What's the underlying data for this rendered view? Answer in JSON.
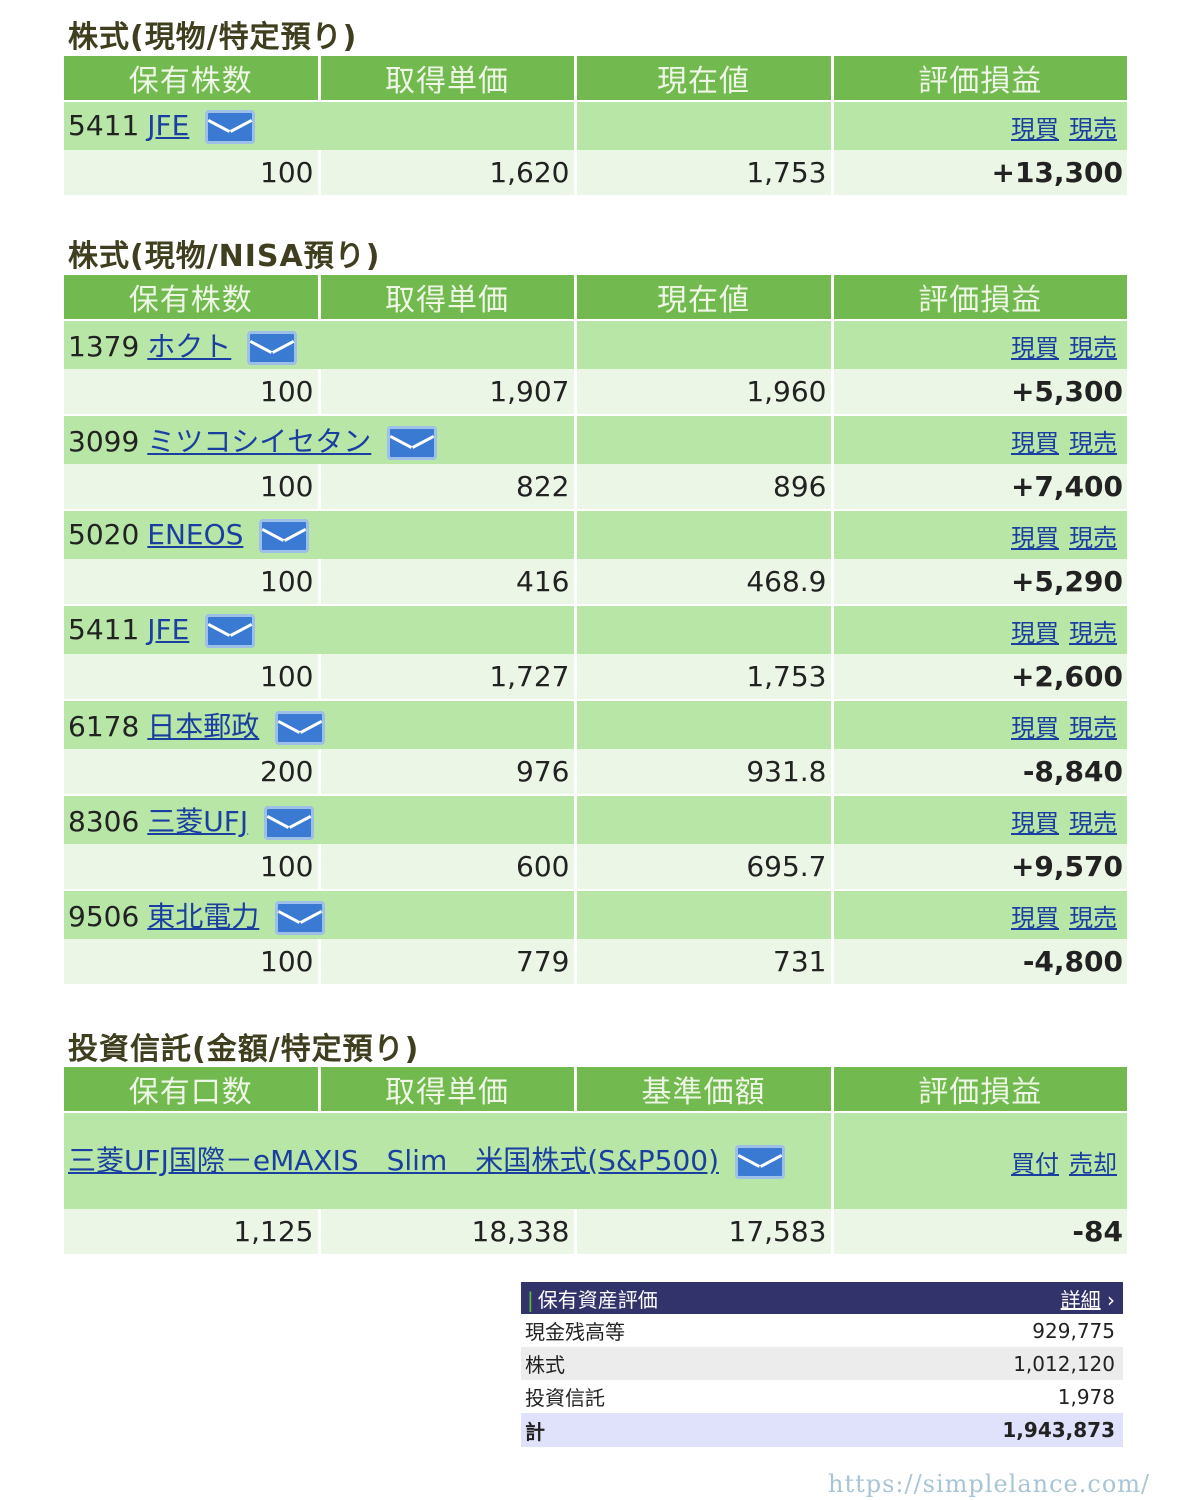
{
  "section1": {
    "title": "株式(現物/特定預り)",
    "headers": [
      "保有株数",
      "取得単価",
      "現在値",
      "評価損益"
    ],
    "stocks": [
      {
        "code": "5411",
        "name": "JFE",
        "buy": "現買",
        "sell": "現売",
        "qty": "100",
        "cost": "1,620",
        "price": "1,753",
        "pl": "+13,300"
      }
    ]
  },
  "section2": {
    "title": "株式(現物/NISA預り)",
    "headers": [
      "保有株数",
      "取得単価",
      "現在値",
      "評価損益"
    ],
    "stocks": [
      {
        "code": "1379",
        "name": "ホクト",
        "buy": "現買",
        "sell": "現売",
        "qty": "100",
        "cost": "1,907",
        "price": "1,960",
        "pl": "+5,300"
      },
      {
        "code": "3099",
        "name": "ミツコシイセタン",
        "buy": "現買",
        "sell": "現売",
        "qty": "100",
        "cost": "822",
        "price": "896",
        "pl": "+7,400"
      },
      {
        "code": "5020",
        "name": "ENEOS",
        "buy": "現買",
        "sell": "現売",
        "qty": "100",
        "cost": "416",
        "price": "468.9",
        "pl": "+5,290"
      },
      {
        "code": "5411",
        "name": "JFE",
        "buy": "現買",
        "sell": "現売",
        "qty": "100",
        "cost": "1,727",
        "price": "1,753",
        "pl": "+2,600"
      },
      {
        "code": "6178",
        "name": "日本郵政",
        "buy": "現買",
        "sell": "現売",
        "qty": "200",
        "cost": "976",
        "price": "931.8",
        "pl": "-8,840"
      },
      {
        "code": "8306",
        "name": "三菱UFJ",
        "buy": "現買",
        "sell": "現売",
        "qty": "100",
        "cost": "600",
        "price": "695.7",
        "pl": "+9,570"
      },
      {
        "code": "9506",
        "name": "東北電力",
        "buy": "現買",
        "sell": "現売",
        "qty": "100",
        "cost": "779",
        "price": "731",
        "pl": "-4,800"
      }
    ]
  },
  "section3": {
    "title": "投資信託(金額/特定預り)",
    "headers": [
      "保有口数",
      "取得単価",
      "基準価額",
      "評価損益"
    ],
    "fund": {
      "name": "三菱UFJ国際－eMAXIS　Slim　米国株式(S&P500)",
      "buy": "買付",
      "sell": "売却",
      "qty": "1,125",
      "cost": "18,338",
      "price": "17,583",
      "pl": "-84"
    }
  },
  "summary": {
    "title": "保有資産評価",
    "detail": "詳細",
    "rows": [
      {
        "label": "現金残高等",
        "value": "929,775"
      },
      {
        "label": "株式",
        "value": "1,012,120"
      },
      {
        "label": "投資信託",
        "value": "1,978"
      }
    ],
    "total": {
      "label": "計",
      "value": "1,943,873"
    }
  },
  "watermark": "https://simplelance.com/",
  "colors": {
    "header_green": "#72b94f",
    "row_green": "#b7e6a7",
    "gain": "#f00000",
    "loss": "#1a22e0",
    "summary_head": "#33336b"
  }
}
